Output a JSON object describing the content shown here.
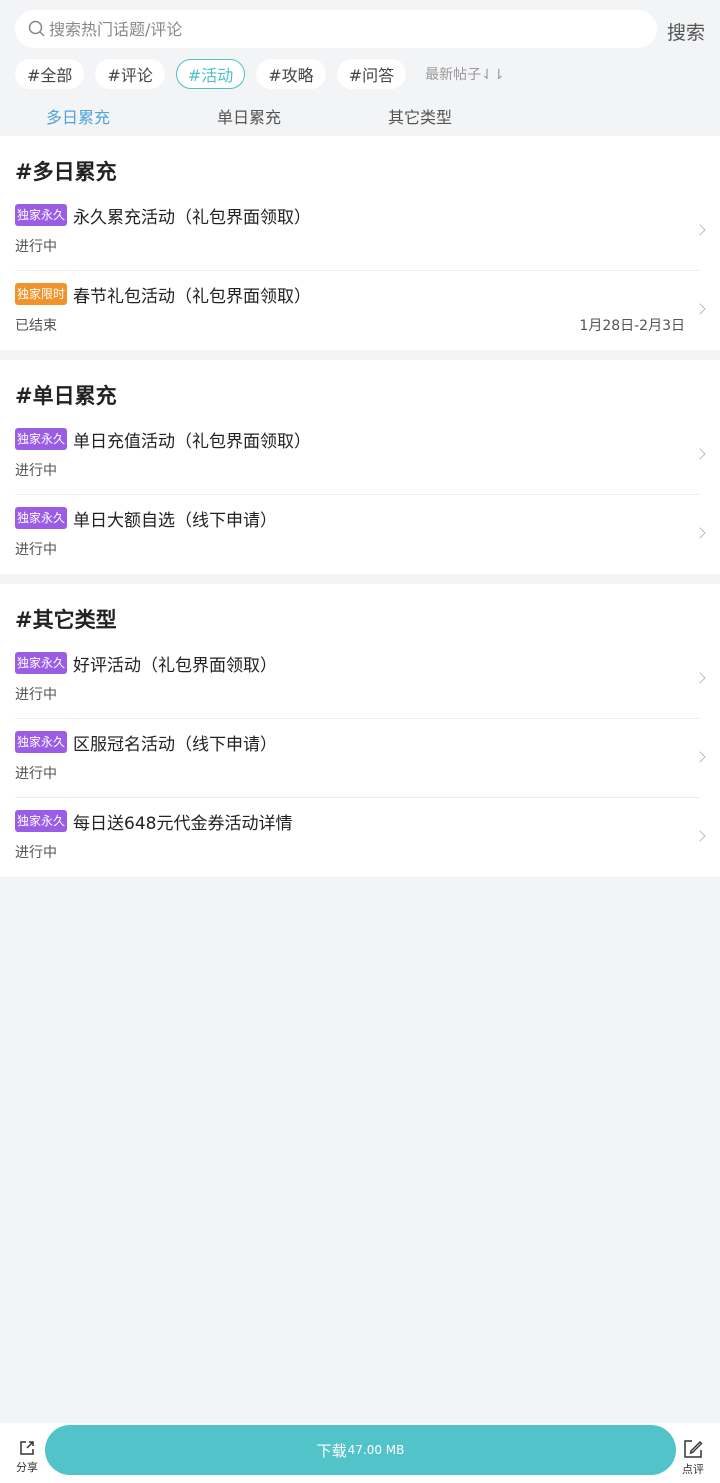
{
  "search": {
    "placeholder": "搜索热门话题/评论",
    "button": "搜索"
  },
  "chips": [
    "#全部",
    "#评论",
    "#活动",
    "#攻略",
    "#问答"
  ],
  "sort_label": "最新帖子⇃⇂",
  "subtabs": [
    "多日累充",
    "单日累充",
    "其它类型"
  ],
  "sections": [
    {
      "title": "#多日累充",
      "items": [
        {
          "tag": "独家永久",
          "title": "永久累充活动（礼包界面领取）",
          "status": "进行中",
          "date": ""
        },
        {
          "tag": "独家限时",
          "title": "春节礼包活动（礼包界面领取）",
          "status": "已结束",
          "date": "1月28日-2月3日"
        }
      ]
    },
    {
      "title": "#单日累充",
      "items": [
        {
          "tag": "独家永久",
          "title": "单日充值活动（礼包界面领取）",
          "status": "进行中",
          "date": ""
        },
        {
          "tag": "独家永久",
          "title": "单日大额自选（线下申请）",
          "status": "进行中",
          "date": ""
        }
      ]
    },
    {
      "title": "#其它类型",
      "items": [
        {
          "tag": "独家永久",
          "title": "好评活动（礼包界面领取）",
          "status": "进行中",
          "date": ""
        },
        {
          "tag": "独家永久",
          "title": "区服冠名活动（线下申请）",
          "status": "进行中",
          "date": ""
        },
        {
          "tag": "独家永久",
          "title": "每日送648元代金券活动详情",
          "status": "进行中",
          "date": ""
        }
      ]
    }
  ],
  "bottom": {
    "share": "分享",
    "download": "下载",
    "size": "47.00 MB",
    "review": "点评"
  },
  "colors": {
    "accent": "#4fbfc5",
    "tab_active": "#4fa3dc",
    "tag_permanent": "#9b5de5",
    "tag_limited": "#f0932b",
    "download_bg": "#52c3c8"
  }
}
